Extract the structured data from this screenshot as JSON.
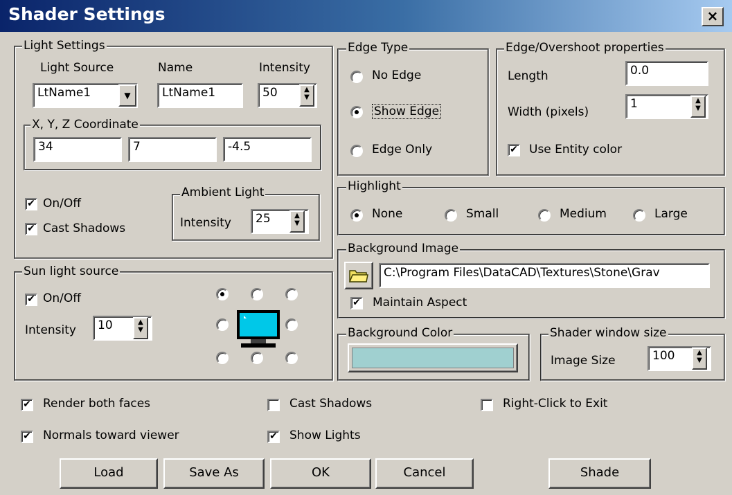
{
  "window": {
    "title": "Shader Settings",
    "close_glyph": "×"
  },
  "light_settings": {
    "title": "Light Settings",
    "light_source_label": "Light Source",
    "name_label": "Name",
    "intensity_label": "Intensity",
    "light_source_value": "LtName1",
    "name_value": "LtName1",
    "intensity_value": "50",
    "coords_title": "X, Y, Z Coordinate",
    "x": "34",
    "y": "7",
    "z": "-4.5",
    "on_off_label": "On/Off",
    "on_off_checked": true,
    "cast_shadows_label": "Cast Shadows",
    "cast_shadows_checked": true,
    "ambient_title": "Ambient Light",
    "ambient_intensity_label": "Intensity",
    "ambient_intensity_value": "25"
  },
  "sun_light": {
    "title": "Sun light source",
    "on_off_label": "On/Off",
    "on_off_checked": true,
    "intensity_label": "Intensity",
    "intensity_value": "10",
    "selected_position": "top-left",
    "icon": "monitor-icon"
  },
  "edge_type": {
    "title": "Edge Type",
    "options": [
      "No Edge",
      "Show Edge",
      "Edge Only"
    ],
    "selected": "Show Edge"
  },
  "edge_props": {
    "title": "Edge/Overshoot properties",
    "length_label": "Length",
    "length_value": "0.0",
    "width_label": "Width (pixels)",
    "width_value": "1",
    "use_entity_color_label": "Use Entity color",
    "use_entity_color_checked": true
  },
  "highlight": {
    "title": "Highlight",
    "options": [
      "None",
      "Small",
      "Medium",
      "Large"
    ],
    "selected": "None"
  },
  "background_image": {
    "title": "Background Image",
    "path": "C:\\Program Files\\DataCAD\\Textures\\Stone\\Grav",
    "maintain_aspect_label": "Maintain Aspect",
    "maintain_aspect_checked": true,
    "icon": "folder-icon"
  },
  "background_color": {
    "title": "Background Color",
    "swatch": "#a0d0d0"
  },
  "window_size": {
    "title": "Shader window size",
    "image_size_label": "Image Size",
    "image_size_value": "100"
  },
  "options": {
    "render_both_faces": "Render both faces",
    "normals_toward_viewer": "Normals toward viewer",
    "cast_shadows": "Cast Shadows",
    "show_lights": "Show Lights",
    "right_click_exit": "Right-Click to Exit"
  },
  "buttons": {
    "load": "Load",
    "save_as": "Save As",
    "ok": "OK",
    "cancel": "Cancel",
    "shade": "Shade"
  },
  "glyphs": {
    "check": "✔",
    "up": "▲",
    "down": "▼"
  }
}
